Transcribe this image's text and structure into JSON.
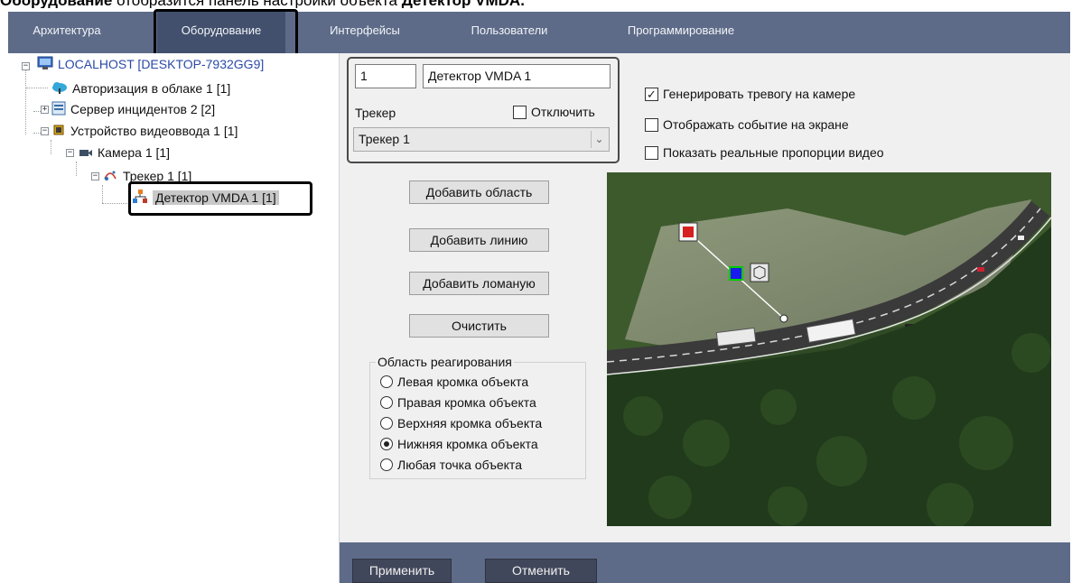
{
  "caption": {
    "prefix": "Оборудование",
    "middle": " отобразится панель настройки объекта ",
    "suffix": "Детектор VMDA."
  },
  "nav": {
    "tabs": [
      {
        "label": "Архитектура"
      },
      {
        "label": "Оборудование"
      },
      {
        "label": "Интерфейсы"
      },
      {
        "label": "Пользователи"
      },
      {
        "label": "Программирование"
      }
    ],
    "active_index": 1
  },
  "tree": {
    "items": [
      {
        "label": "LOCALHOST [DESKTOP-7932GG9]"
      },
      {
        "label": "Авторизация в облаке 1 [1]"
      },
      {
        "label": "Сервер инцидентов 2 [2]"
      },
      {
        "label": "Устройство видеоввода 1 [1]"
      },
      {
        "label": "Камера 1 [1]"
      },
      {
        "label": "Трекер 1 [1]"
      },
      {
        "label": "Детектор VMDA 1 [1]"
      }
    ]
  },
  "settings": {
    "id_value": "1",
    "name_value": "Детектор VMDA 1",
    "tracker_label": "Трекер",
    "disable_label": "Отключить",
    "disable_checked": false,
    "tracker_select_value": "Трекер 1",
    "checkboxes": [
      {
        "label": "Генерировать тревогу на камере",
        "checked": true
      },
      {
        "label": "Отображать событие на экране",
        "checked": false
      },
      {
        "label": "Показать реальные пропорции видео",
        "checked": false
      }
    ],
    "buttons": {
      "add_area": "Добавить область",
      "add_line": "Добавить линию",
      "add_polyline": "Добавить ломаную",
      "clear": "Очистить"
    },
    "reaction_area": {
      "title": "Область реагирования",
      "options": [
        "Левая кромка объекта",
        "Правая кромка объекта",
        "Верхняя кромка объекта",
        "Нижняя кромка объекта",
        "Любая точка объекта"
      ],
      "selected_index": 3
    }
  },
  "footer": {
    "apply_label": "Применить",
    "cancel_label": "Отменить"
  },
  "colors": {
    "nav_bar": "#5d6b88",
    "active_tab": "#42506d",
    "panel_bg": "#f0f0f0",
    "footer_button": "#41475a"
  }
}
